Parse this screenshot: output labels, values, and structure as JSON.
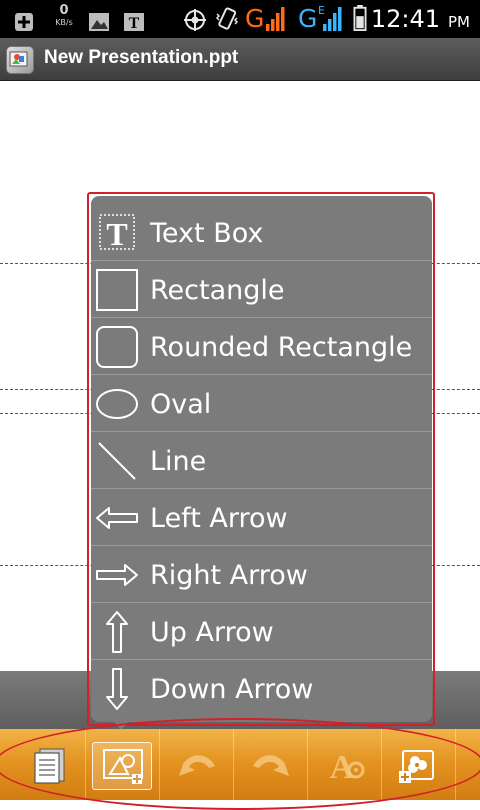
{
  "status_bar": {
    "data_speed": "0",
    "data_unit": "KB/s",
    "network_1": "G",
    "network_2": "G",
    "network_2_sup": "E",
    "time": "12:41",
    "ampm": "PM",
    "icons": [
      "add-icon",
      "image-icon",
      "text-icon",
      "gps-icon",
      "vibrate-icon",
      "signal-icon",
      "battery-icon"
    ]
  },
  "title_bar": {
    "title": "New Presentation.ppt",
    "icon": "presentation-app-icon"
  },
  "shape_menu": {
    "items": [
      {
        "label": "Text Box",
        "icon": "text-box-icon"
      },
      {
        "label": "Rectangle",
        "icon": "rectangle-icon"
      },
      {
        "label": "Rounded Rectangle",
        "icon": "rounded-rectangle-icon"
      },
      {
        "label": "Oval",
        "icon": "oval-icon"
      },
      {
        "label": "Line",
        "icon": "line-icon"
      },
      {
        "label": "Left Arrow",
        "icon": "left-arrow-icon"
      },
      {
        "label": "Right Arrow",
        "icon": "right-arrow-icon"
      },
      {
        "label": "Up Arrow",
        "icon": "up-arrow-icon"
      },
      {
        "label": "Down Arrow",
        "icon": "down-arrow-icon"
      }
    ]
  },
  "toolbar": {
    "buttons": [
      {
        "icon": "slides-icon",
        "enabled": true
      },
      {
        "icon": "insert-shape-icon",
        "enabled": true,
        "active": true
      },
      {
        "icon": "undo-icon",
        "enabled": false
      },
      {
        "icon": "redo-icon",
        "enabled": false
      },
      {
        "icon": "text-format-icon",
        "enabled": false
      },
      {
        "icon": "insert-image-icon",
        "enabled": true
      }
    ]
  },
  "colors": {
    "toolbar": "#e2911f",
    "menu": "#7b7b7b",
    "highlight": "#d21f2a"
  }
}
